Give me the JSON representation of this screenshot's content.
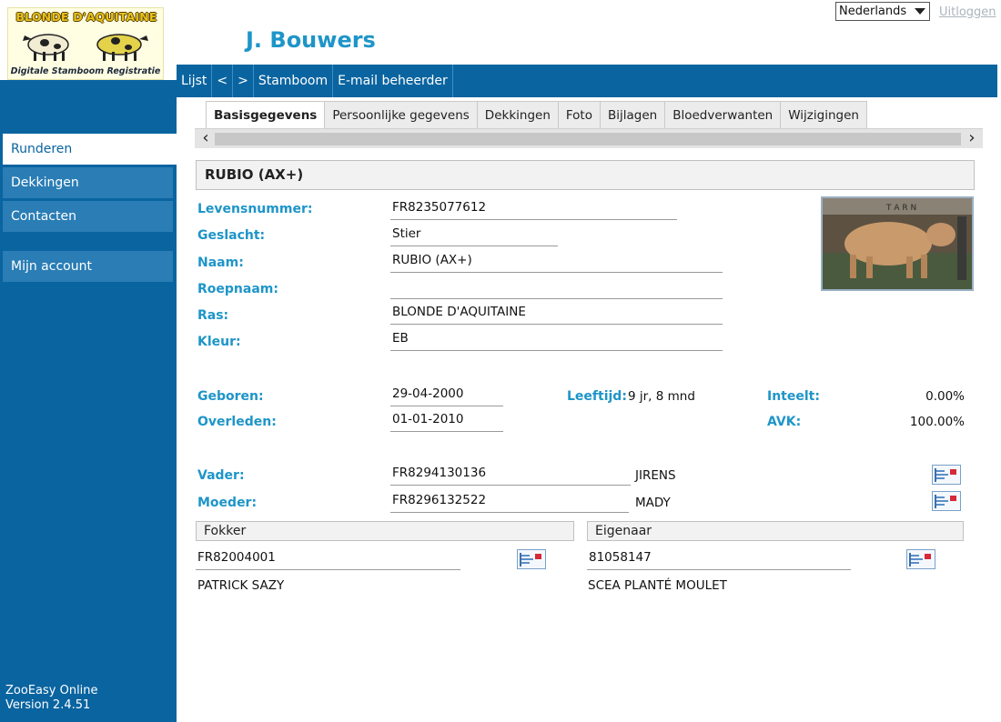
{
  "logo": {
    "brand_text": "BLONDE D'AQUITAINE",
    "subtitle": "Digitale Stamboom Registratie"
  },
  "sidebar": {
    "items": [
      {
        "label": "Runderen",
        "active": true
      },
      {
        "label": "Dekkingen",
        "active": false
      },
      {
        "label": "Contacten",
        "active": false
      },
      {
        "label": "Mijn account",
        "active": false
      }
    ],
    "footer_line1": "ZooEasy Online",
    "footer_line2": "Version 2.4.51"
  },
  "header": {
    "user_name": "J. Bouwers",
    "language": "Nederlands",
    "logout": "Uitloggen"
  },
  "toolbar": {
    "items": [
      "Lijst",
      "<",
      ">",
      "Stamboom",
      "E-mail beheerder"
    ]
  },
  "tabs": [
    {
      "label": "Basisgegevens",
      "active": true
    },
    {
      "label": "Persoonlijke gegevens",
      "active": false
    },
    {
      "label": "Dekkingen",
      "active": false
    },
    {
      "label": "Foto",
      "active": false
    },
    {
      "label": "Bijlagen",
      "active": false
    },
    {
      "label": "Bloedverwanten",
      "active": false
    },
    {
      "label": "Wijzigingen",
      "active": false
    }
  ],
  "scroll": {
    "left": "<",
    "right": ">"
  },
  "record": {
    "title": "RUBIO (AX+)",
    "levensnummer_label": "Levensnummer:",
    "levensnummer": "FR8235077612",
    "geslacht_label": "Geslacht:",
    "geslacht": "Stier",
    "naam_label": "Naam:",
    "naam": "RUBIO (AX+)",
    "roepnaam_label": "Roepnaam:",
    "roepnaam": "",
    "ras_label": "Ras:",
    "ras": "BLONDE D'AQUITAINE",
    "kleur_label": "Kleur:",
    "kleur": "EB",
    "geboren_label": "Geboren:",
    "geboren": "29-04-2000",
    "overleden_label": "Overleden:",
    "overleden": "01-01-2010",
    "leeftijd_label": "Leeftijd:",
    "leeftijd": "9 jr, 8 mnd",
    "inteelt_label": "Inteelt:",
    "inteelt": "0.00%",
    "avk_label": "AVK:",
    "avk": "100.00%",
    "vader_label": "Vader:",
    "vader_nummer": "FR8294130136",
    "vader_naam": "JIRENS",
    "moeder_label": "Moeder:",
    "moeder_nummer": "FR8296132522",
    "moeder_naam": "MADY"
  },
  "fokker": {
    "header": "Fokker",
    "nummer": "FR82004001",
    "naam": "PATRICK SAZY"
  },
  "eigenaar": {
    "header": "Eigenaar",
    "nummer": "81058147",
    "naam": "SCEA PLANTÉ MOULET"
  }
}
